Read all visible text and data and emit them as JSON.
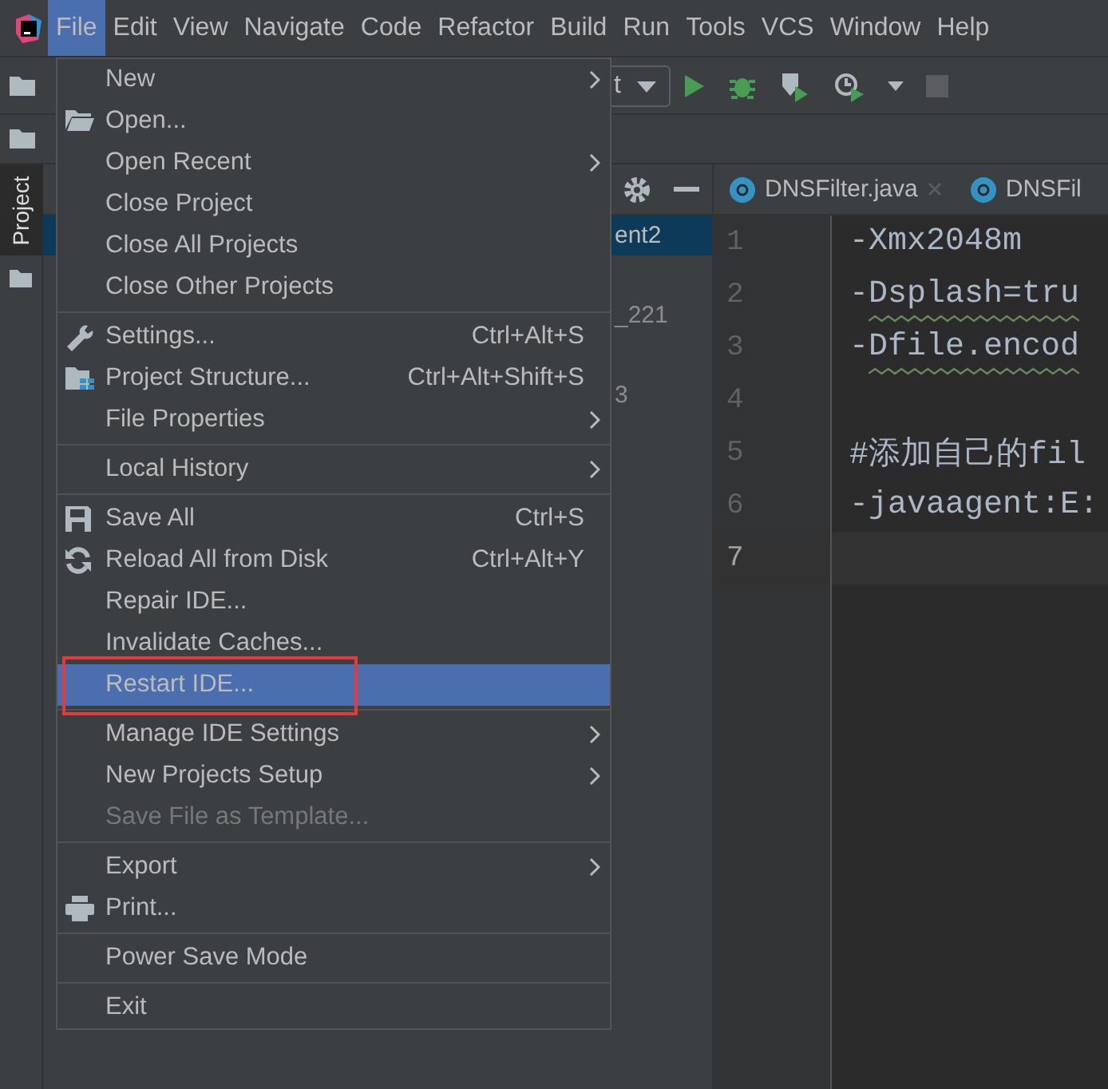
{
  "menu_bar": [
    {
      "label": "File",
      "selected": true
    },
    {
      "label": "Edit",
      "selected": false
    },
    {
      "label": "View",
      "selected": false
    },
    {
      "label": "Navigate",
      "selected": false
    },
    {
      "label": "Code",
      "selected": false
    },
    {
      "label": "Refactor",
      "selected": false
    },
    {
      "label": "Build",
      "selected": false
    },
    {
      "label": "Run",
      "selected": false
    },
    {
      "label": "Tools",
      "selected": false
    },
    {
      "label": "VCS",
      "selected": false
    },
    {
      "label": "Window",
      "selected": false
    },
    {
      "label": "Help",
      "selected": false
    }
  ],
  "toolbar": {
    "run_config": "t"
  },
  "side_tab": {
    "label": "Project"
  },
  "project_rows": [
    {
      "text": "ent2",
      "selected": true
    },
    {
      "text": "_221",
      "selected": false
    },
    {
      "text": "3",
      "selected": false
    }
  ],
  "editor_tabs": [
    {
      "label": "DNSFilter.java",
      "closable": true
    },
    {
      "label": "DNSFil",
      "closable": false
    }
  ],
  "code_lines": [
    {
      "number": "1",
      "text": "-Xmx2048m",
      "current": false
    },
    {
      "number": "2",
      "text": "-Dsplash=tru",
      "warned": true,
      "current": false
    },
    {
      "number": "3",
      "text": "-Dfile.encod",
      "warned": true,
      "current": false
    },
    {
      "number": "4",
      "current": false
    },
    {
      "number": "5",
      "text": "#添加自己的fil",
      "current": false
    },
    {
      "number": "6",
      "text": "-javaagent:E:",
      "current": false
    },
    {
      "number": "7",
      "current": true
    }
  ],
  "file_menu": [
    {
      "kind": "item",
      "label": "New",
      "submenu": true,
      "selected": false,
      "disabled": false,
      "outlined": false
    },
    {
      "kind": "item",
      "label": "Open...",
      "selected": false,
      "disabled": false,
      "outlined": false
    },
    {
      "kind": "item",
      "label": "Open Recent",
      "submenu": true,
      "selected": false,
      "disabled": false,
      "outlined": false
    },
    {
      "kind": "item",
      "label": "Close Project",
      "selected": false,
      "disabled": false,
      "outlined": false
    },
    {
      "kind": "item",
      "label": "Close All Projects",
      "selected": false,
      "disabled": false,
      "outlined": false
    },
    {
      "kind": "item",
      "label": "Close Other Projects",
      "selected": false,
      "disabled": false,
      "outlined": false
    },
    {
      "kind": "separator"
    },
    {
      "kind": "item",
      "label": "Settings...",
      "shortcut": "Ctrl+Alt+S",
      "selected": false,
      "disabled": false,
      "outlined": false
    },
    {
      "kind": "item",
      "label": "Project Structure...",
      "shortcut": "Ctrl+Alt+Shift+S",
      "selected": false,
      "disabled": false,
      "outlined": false
    },
    {
      "kind": "item",
      "label": "File Properties",
      "submenu": true,
      "selected": false,
      "disabled": false,
      "outlined": false
    },
    {
      "kind": "separator"
    },
    {
      "kind": "item",
      "label": "Local History",
      "submenu": true,
      "selected": false,
      "disabled": false,
      "outlined": false
    },
    {
      "kind": "separator"
    },
    {
      "kind": "item",
      "label": "Save All",
      "shortcut": "Ctrl+S",
      "selected": false,
      "disabled": false,
      "outlined": false
    },
    {
      "kind": "item",
      "label": "Reload All from Disk",
      "shortcut": "Ctrl+Alt+Y",
      "selected": false,
      "disabled": false,
      "outlined": false
    },
    {
      "kind": "item",
      "label": "Repair IDE...",
      "selected": false,
      "disabled": false,
      "outlined": false
    },
    {
      "kind": "item",
      "label": "Invalidate Caches...",
      "selected": false,
      "disabled": false,
      "outlined": false
    },
    {
      "kind": "item",
      "label": "Restart IDE...",
      "selected": true,
      "disabled": false,
      "outlined": true
    },
    {
      "kind": "separator"
    },
    {
      "kind": "item",
      "label": "Manage IDE Settings",
      "submenu": true,
      "selected": false,
      "disabled": false,
      "outlined": false
    },
    {
      "kind": "item",
      "label": "New Projects Setup",
      "submenu": true,
      "selected": false,
      "disabled": false,
      "outlined": false
    },
    {
      "kind": "item",
      "label": "Save File as Template...",
      "selected": false,
      "disabled": true,
      "outlined": false
    },
    {
      "kind": "separator"
    },
    {
      "kind": "item",
      "label": "Export",
      "submenu": true,
      "selected": false,
      "disabled": false,
      "outlined": false
    },
    {
      "kind": "item",
      "label": "Print...",
      "selected": false,
      "disabled": false,
      "outlined": false
    },
    {
      "kind": "separator"
    },
    {
      "kind": "item",
      "label": "Power Save Mode",
      "selected": false,
      "disabled": false,
      "outlined": false
    },
    {
      "kind": "separator"
    },
    {
      "kind": "item",
      "label": "Exit",
      "selected": false,
      "disabled": false,
      "outlined": false
    }
  ]
}
